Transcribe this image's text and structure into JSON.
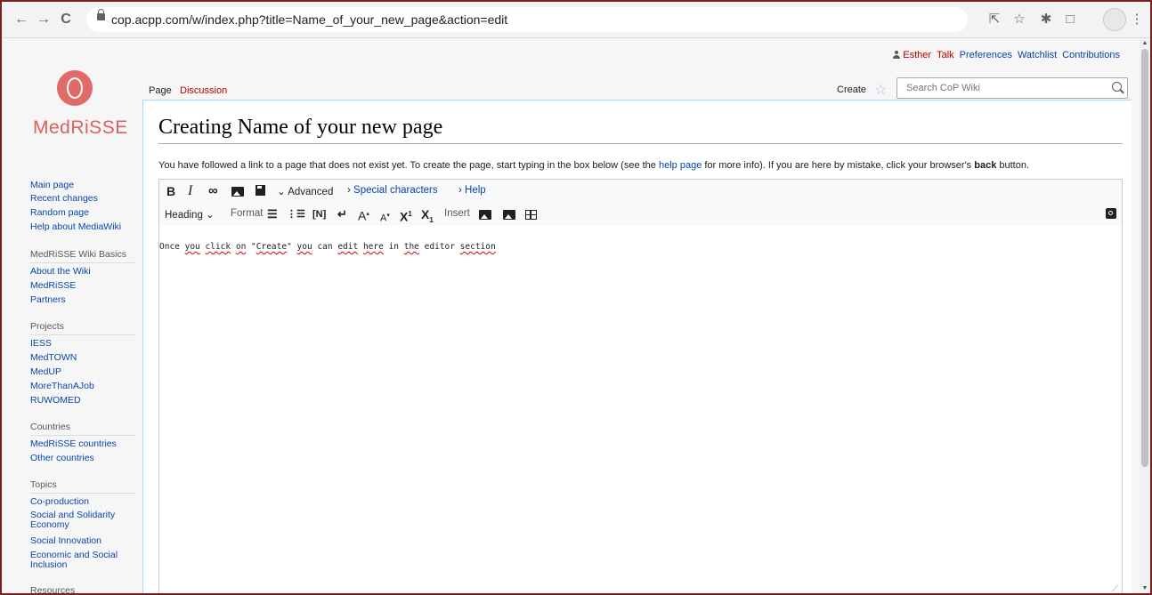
{
  "browser": {
    "url": "cop.acpp.com/w/index.php?title=Name_of_your_new_page&action=edit",
    "back_icon": "←",
    "forward_icon": "→",
    "reload_icon": "C",
    "share_icon": "⇱",
    "bookmark_icon": "☆",
    "extensions_icon": "✱",
    "window_icon": "□",
    "menu_icon": "⋮"
  },
  "personal": {
    "user": "Esther",
    "talk": "Talk",
    "preferences": "Preferences",
    "watchlist": "Watchlist",
    "contributions": "Contributions"
  },
  "brand": {
    "name": "MedRiSSE",
    "color": "#d9615e"
  },
  "tabs": {
    "page": "Page",
    "discussion": "Discussion",
    "create": "Create"
  },
  "search": {
    "placeholder": "Search CoP Wiki"
  },
  "sidebar": {
    "nav": [
      "Main page",
      "Recent changes",
      "Random page",
      "Help about MediaWiki"
    ],
    "sections": [
      {
        "heading": "MedRiSSE Wiki Basics",
        "items": [
          "About the Wiki",
          "MedRiSSE",
          "Partners"
        ]
      },
      {
        "heading": "Projects",
        "items": [
          "IESS",
          "MedTOWN",
          "MedUP",
          "MoreThanAJob",
          "RUWOMED"
        ]
      },
      {
        "heading": "Countries",
        "items": [
          "MedRiSSE countries",
          "Other countries"
        ]
      },
      {
        "heading": "Topics",
        "items": [
          "Co-production",
          "Social and Solidarity Economy",
          "Social Innovation",
          "Economic and Social Inclusion"
        ]
      },
      {
        "heading": "Resources",
        "items": []
      }
    ]
  },
  "main": {
    "title": "Creating Name of your new page",
    "intro_before": "You have followed a link to a page that does not exist yet. To create the page, start typing in the box below (see the ",
    "intro_link": "help page",
    "intro_middle": " for more info). If you are here by mistake, click your browser's ",
    "intro_bold": "back",
    "intro_after": " button."
  },
  "editor": {
    "toolbar1": {
      "bold": "B",
      "italic": "I",
      "link_icon": "∞",
      "advanced": "Advanced",
      "special": "Special characters",
      "help": "Help"
    },
    "toolbar2": {
      "heading": "Heading",
      "format": "Format",
      "bullet_icon": "☰",
      "number_icon": "⋮☰",
      "nowiki_icon": "[N]",
      "newline_icon": "↵",
      "big": "A",
      "small": "A",
      "sup": "X",
      "sub": "X",
      "insert": "Insert"
    },
    "text_parts": [
      "Once ",
      "you",
      " ",
      "click",
      " ",
      "on",
      " \"",
      "Create",
      "\" ",
      "you",
      " can ",
      "edit",
      " ",
      "here",
      " in ",
      "the",
      " editor ",
      "section"
    ]
  },
  "colors": {
    "frame": "#7a1f22",
    "link": "#0645ad",
    "redlink": "#ba0000",
    "content_border": "#a7d7f9"
  }
}
